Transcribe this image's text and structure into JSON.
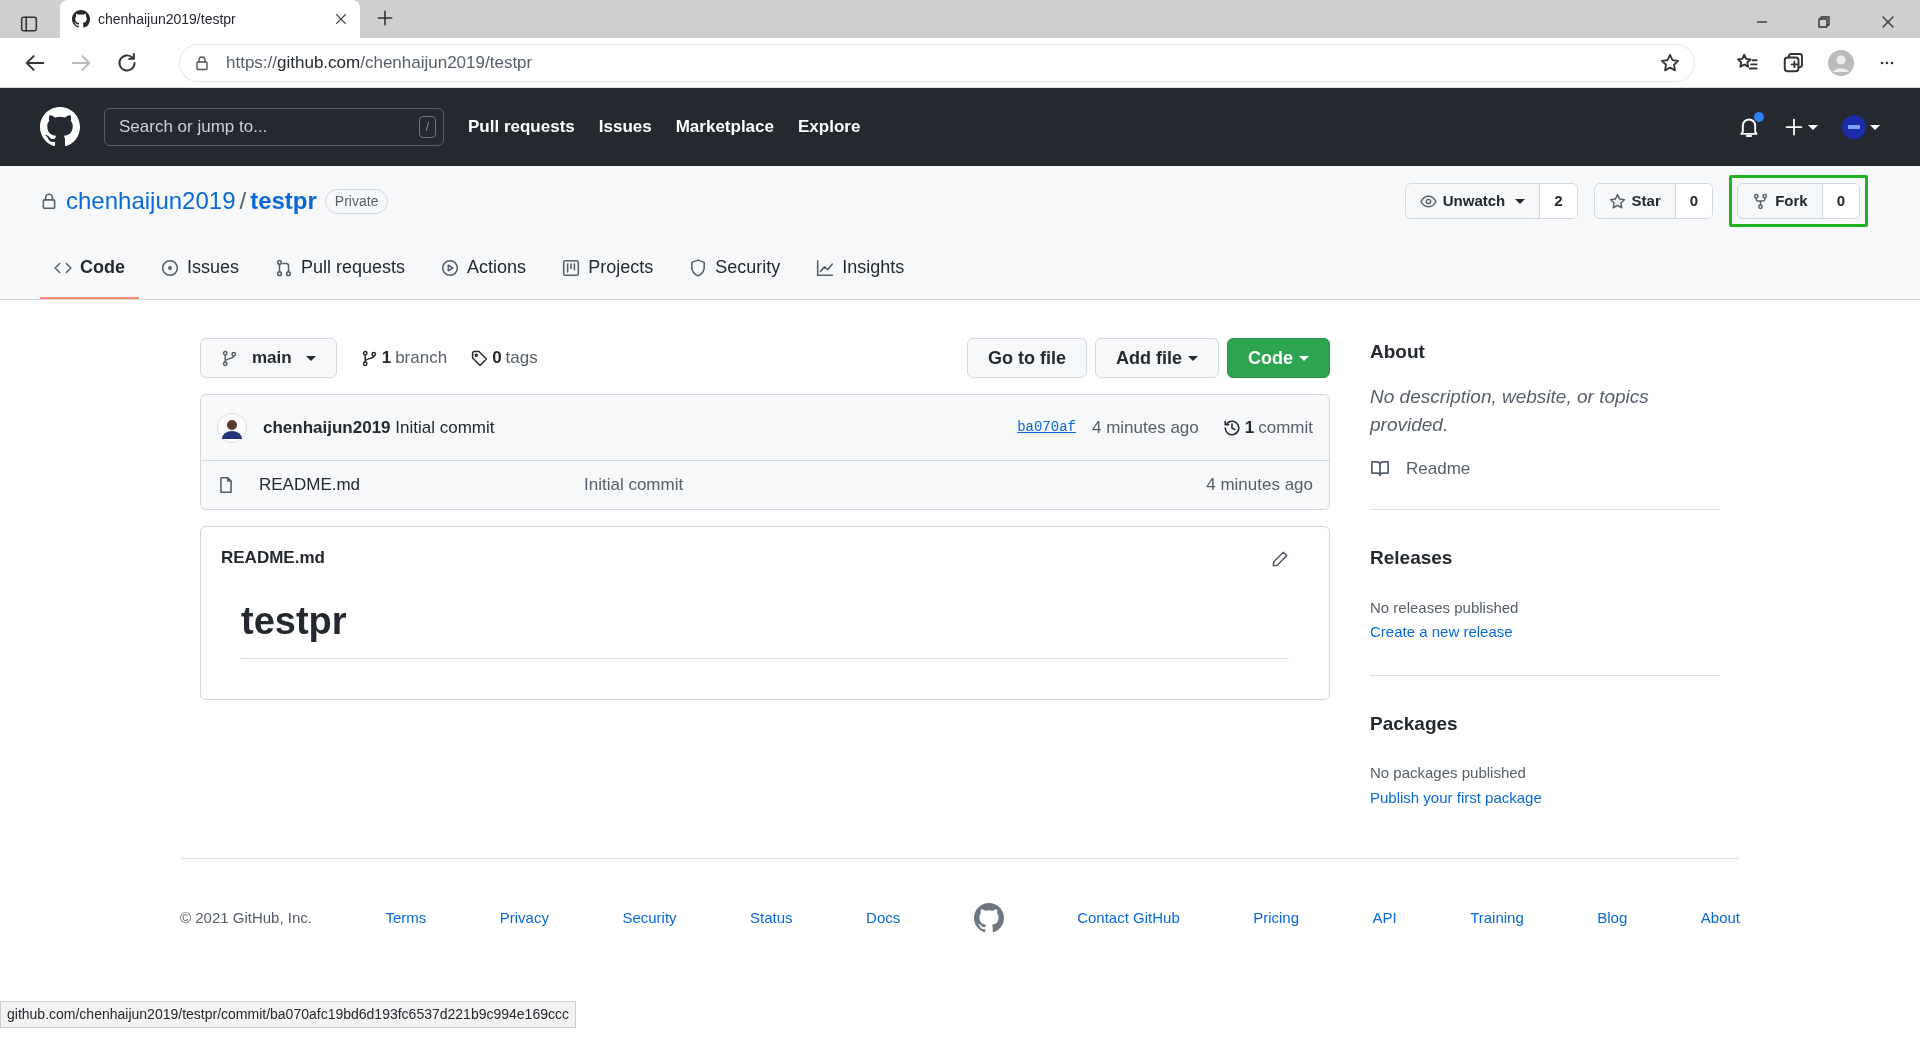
{
  "browser": {
    "tab_title": "chenhaijun2019/testpr",
    "url_scheme": "https://",
    "url_host": "github.com",
    "url_path": "/chenhaijun2019/testpr"
  },
  "github_nav": {
    "search_placeholder": "Search or jump to...",
    "search_key": "/",
    "links": [
      "Pull requests",
      "Issues",
      "Marketplace",
      "Explore"
    ],
    "unread_notifications": true
  },
  "repo": {
    "owner": "chenhaijun2019",
    "separator": "/",
    "name": "testpr",
    "visibility": "Private",
    "actions": [
      {
        "kind": "watch",
        "label": "Unwatch",
        "count": "2",
        "dropdown": true,
        "highlighted": false
      },
      {
        "kind": "star",
        "label": "Star",
        "count": "0",
        "dropdown": false,
        "highlighted": false
      },
      {
        "kind": "fork",
        "label": "Fork",
        "count": "0",
        "dropdown": false,
        "highlighted": true
      }
    ]
  },
  "tabs": [
    {
      "kind": "code",
      "label": "Code",
      "selected": true
    },
    {
      "kind": "issues",
      "label": "Issues",
      "selected": false
    },
    {
      "kind": "pulls",
      "label": "Pull requests",
      "selected": false
    },
    {
      "kind": "actions",
      "label": "Actions",
      "selected": false
    },
    {
      "kind": "projects",
      "label": "Projects",
      "selected": false
    },
    {
      "kind": "security",
      "label": "Security",
      "selected": false
    },
    {
      "kind": "insights",
      "label": "Insights",
      "selected": false
    }
  ],
  "toolbar": {
    "branch": "main",
    "branches_count": "1",
    "branches_label": "branch",
    "tags_count": "0",
    "tags_label": "tags",
    "buttons": [
      {
        "kind": "plain",
        "label": "Go to file",
        "dropdown": false
      },
      {
        "kind": "plain",
        "label": "Add file",
        "dropdown": true
      },
      {
        "kind": "primary",
        "label": "Code",
        "dropdown": true
      }
    ]
  },
  "latest_commit": {
    "author": "chenhaijun2019",
    "message": "Initial commit",
    "sha": "ba070af",
    "time": "4 minutes ago",
    "commits_count": "1",
    "commits_label": "commit"
  },
  "files": [
    {
      "name": "README.md",
      "message": "Initial commit",
      "time": "4 minutes ago"
    }
  ],
  "readme": {
    "filename": "README.md",
    "heading": "testpr"
  },
  "about": {
    "title": "About",
    "description": "No description, website, or topics provided.",
    "readme_link": "Readme"
  },
  "releases": {
    "title": "Releases",
    "note": "No releases published",
    "link": "Create a new release"
  },
  "packages": {
    "title": "Packages",
    "note": "No packages published",
    "link": "Publish your first package"
  },
  "footer": {
    "copyright": "© 2021 GitHub, Inc.",
    "left_links": [
      "Terms",
      "Privacy",
      "Security",
      "Status",
      "Docs"
    ],
    "right_links": [
      "Contact GitHub",
      "Pricing",
      "API",
      "Training",
      "Blog",
      "About"
    ]
  },
  "status_bar": {
    "url": "github.com/chenhaijun2019/testpr/commit/ba070afc19bd6d193fc6537d221b9c994e169ccc"
  }
}
